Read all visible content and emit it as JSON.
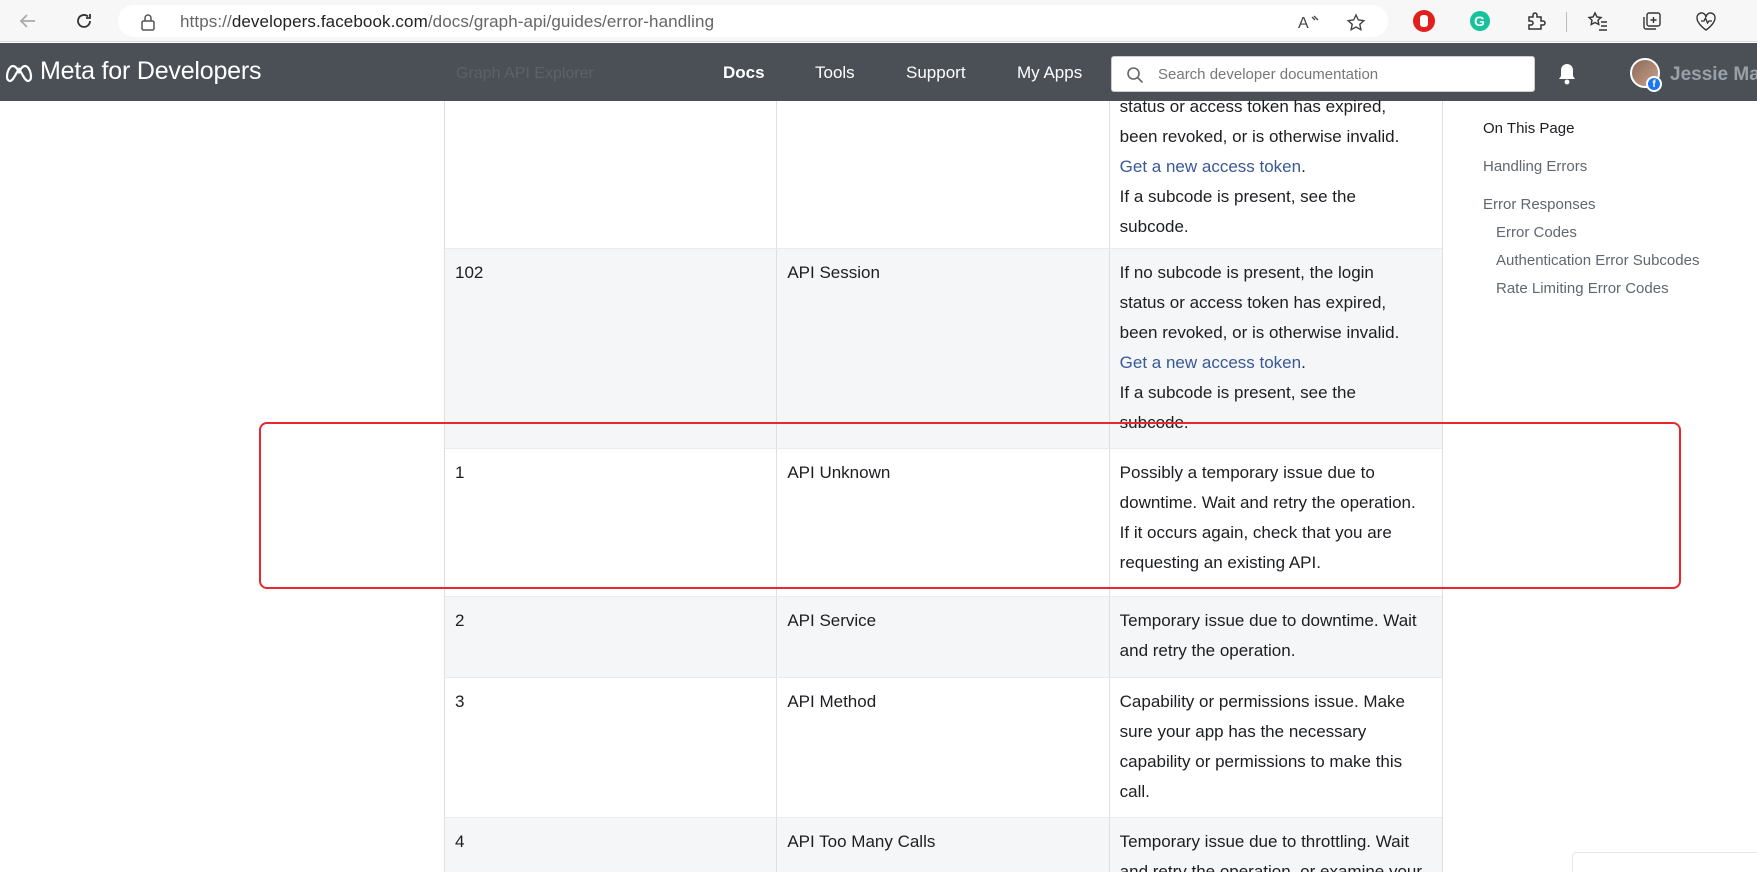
{
  "browser": {
    "url_prefix": "https://",
    "url_host": "developers.facebook.com",
    "url_path": "/docs/graph-api/guides/error-handling"
  },
  "header": {
    "brand": "Meta for Developers",
    "ghost_text": "Graph API Explorer",
    "nav": [
      "Docs",
      "Tools",
      "Support",
      "My Apps"
    ],
    "search_placeholder": "Search developer documentation",
    "user_name": "Jessie Ma"
  },
  "table": {
    "rows": [
      {
        "code": "",
        "name": "",
        "lines": [
          "status or access token has expired,",
          "been revoked, or is otherwise invalid."
        ],
        "link": "Get a new access token",
        "link_suffix": ".",
        "after": [
          "If a subcode is present, see the",
          "subcode."
        ]
      },
      {
        "code": "102",
        "name": "API Session",
        "lines": [
          "If no subcode is present, the login",
          "status or access token has expired,",
          "been revoked, or is otherwise invalid."
        ],
        "link": "Get a new access token",
        "link_suffix": ".",
        "after": [
          "If a subcode is present, see the",
          "subcode."
        ]
      },
      {
        "code": "1",
        "name": "API Unknown",
        "lines": [
          "Possibly a temporary issue due to",
          "downtime. Wait and retry the operation.",
          "If it occurs again, check that you are",
          "requesting an existing API."
        ]
      },
      {
        "code": "2",
        "name": "API Service",
        "lines": [
          "Temporary issue due to downtime. Wait",
          "and retry the operation."
        ]
      },
      {
        "code": "3",
        "name": "API Method",
        "lines": [
          "Capability or permissions issue. Make",
          "sure your app has the necessary",
          "capability or permissions to make this",
          "call."
        ]
      },
      {
        "code": "4",
        "name": "API Too Many Calls",
        "lines": [
          "Temporary issue due to throttling. Wait",
          "and retry the operation, or examine your"
        ]
      }
    ]
  },
  "toc": {
    "title": "On This Page",
    "items": [
      "Handling Errors",
      "Error Responses"
    ],
    "subitems": [
      "Error Codes",
      "Authentication Error Subcodes",
      "Rate Limiting Error Codes"
    ]
  },
  "colors": {
    "header_bg": "#4b4f56",
    "link": "#385898",
    "highlight": "#e8282b"
  }
}
